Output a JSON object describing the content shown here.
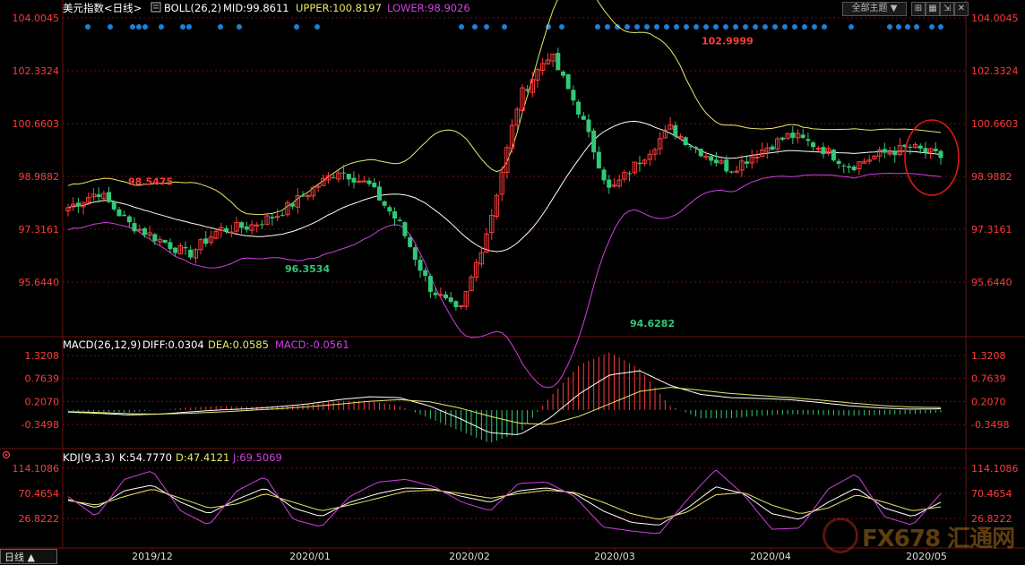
{
  "header": {
    "title": "美元指数<日线>",
    "boll_label": "BOLL(26,2)",
    "mid": "MID:99.8611",
    "upper": "UPPER:100.8197",
    "lower": "LOWER:98.9026",
    "selector": "全部主题 ▼"
  },
  "colors": {
    "background": "#000000",
    "up": "#ff3b3b",
    "down": "#32c878",
    "mid": "#ffffff",
    "upper": "#e8e86a",
    "lower": "#d040e0",
    "axis_label": "#ff3b3b",
    "dots": "#1e7fd8",
    "grid": "#6e1010"
  },
  "bottom_tab": "日线 ▲",
  "watermark": "FX678 汇通网",
  "chart_data": [
    {
      "type": "candlestick",
      "name": "BOLL",
      "x": [
        "2019/12",
        "2020/01",
        "2020/02",
        "2020/03",
        "2020/04",
        "2020/05"
      ],
      "y_ticks": [
        "104.0045",
        "102.3324",
        "100.6603",
        "98.9882",
        "97.3161",
        "95.6440"
      ],
      "ylim": [
        95.0,
        104.0045
      ],
      "annotations": [
        {
          "text": "98.5475",
          "value": 98.5475,
          "kind": "high"
        },
        {
          "text": "96.3534",
          "value": 96.3534,
          "kind": "low"
        },
        {
          "text": "102.9999",
          "value": 102.9999,
          "kind": "high"
        },
        {
          "text": "94.6282",
          "value": 94.6282,
          "kind": "low"
        }
      ],
      "ohlc_summary": {
        "note_values": [
          98.0,
          98.5,
          97.5,
          97.0,
          96.5,
          97.3,
          97.4,
          97.8,
          98.5,
          99.2,
          98.7,
          97.5,
          95.5,
          94.6,
          97.5,
          101.5,
          102.9,
          101.0,
          98.5,
          99.5,
          100.5,
          99.8,
          99.2,
          99.8,
          100.3,
          99.9,
          99.3,
          99.7,
          99.9,
          99.6
        ]
      }
    },
    {
      "type": "line",
      "name": "MACD",
      "header": "MACD(26,12,9)",
      "diff": "DIFF:0.0304",
      "dea": "DEA:0.0585",
      "macd": "MACD:-0.0561",
      "y_ticks": [
        "1.3208",
        "0.7639",
        "0.2070",
        "-0.3498"
      ],
      "ylim": [
        -0.75,
        1.45
      ],
      "diff_values": [
        -0.05,
        -0.08,
        -0.12,
        -0.1,
        -0.05,
        0.0,
        0.03,
        0.08,
        0.15,
        0.25,
        0.32,
        0.3,
        0.1,
        -0.2,
        -0.55,
        -0.6,
        -0.2,
        0.4,
        0.85,
        0.95,
        0.6,
        0.38,
        0.3,
        0.28,
        0.25,
        0.18,
        0.1,
        0.05,
        0.02,
        0.03
      ],
      "dea_values": [
        -0.04,
        -0.06,
        -0.09,
        -0.1,
        -0.08,
        -0.05,
        -0.01,
        0.03,
        0.08,
        0.14,
        0.21,
        0.25,
        0.2,
        0.05,
        -0.15,
        -0.32,
        -0.35,
        -0.15,
        0.15,
        0.45,
        0.55,
        0.48,
        0.4,
        0.35,
        0.3,
        0.24,
        0.17,
        0.11,
        0.07,
        0.06
      ]
    },
    {
      "type": "line",
      "name": "KDJ",
      "header": "KDJ(9,3,3)",
      "k": "K:54.7770",
      "d": "D:47.4121",
      "j": "J:69.5069",
      "y_ticks": [
        "114.1086",
        "70.4654",
        "26.8222"
      ],
      "ylim": [
        0,
        118
      ],
      "k_values": [
        60,
        45,
        75,
        85,
        55,
        35,
        60,
        80,
        45,
        30,
        55,
        70,
        80,
        78,
        65,
        55,
        75,
        80,
        70,
        40,
        20,
        15,
        45,
        82,
        70,
        35,
        25,
        55,
        80,
        45,
        30,
        55
      ],
      "d_values": [
        58,
        50,
        65,
        78,
        62,
        45,
        52,
        70,
        55,
        40,
        50,
        62,
        74,
        76,
        70,
        62,
        70,
        76,
        72,
        55,
        35,
        25,
        38,
        68,
        72,
        50,
        35,
        45,
        68,
        55,
        40,
        47
      ],
      "j_values": [
        65,
        30,
        95,
        110,
        40,
        15,
        75,
        100,
        25,
        12,
        65,
        90,
        95,
        82,
        55,
        40,
        88,
        90,
        65,
        12,
        5,
        0,
        60,
        112,
        68,
        8,
        10,
        78,
        105,
        30,
        15,
        70
      ]
    }
  ]
}
